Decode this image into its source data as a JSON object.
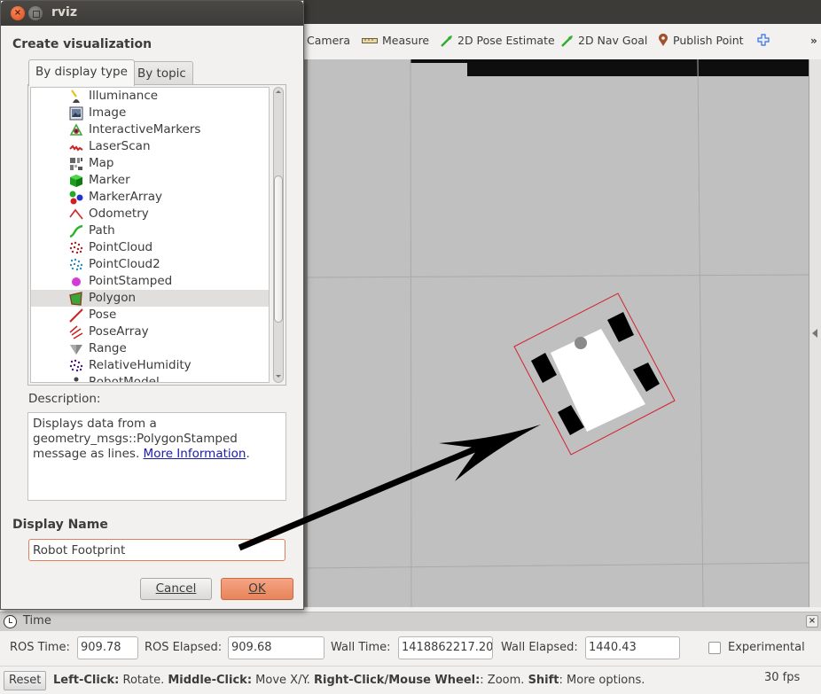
{
  "window": {
    "title": "rviz"
  },
  "toolbar": {
    "items": [
      {
        "label": "Camera",
        "icon": "camera-icon"
      },
      {
        "label": "Measure",
        "icon": "ruler-icon"
      },
      {
        "label": "2D Pose Estimate",
        "icon": "green-arrow-icon"
      },
      {
        "label": "2D Nav Goal",
        "icon": "green-arrow-icon"
      },
      {
        "label": "Publish Point",
        "icon": "map-pin-icon"
      },
      {
        "label": "",
        "icon": "plus-icon"
      }
    ],
    "overflow": "»"
  },
  "dialog": {
    "heading": "Create visualization",
    "tabs": [
      {
        "label": "By display type",
        "active": true
      },
      {
        "label": "By topic",
        "active": false
      }
    ],
    "display_types": [
      {
        "label": "Illuminance",
        "icon": "illuminance-icon"
      },
      {
        "label": "Image",
        "icon": "image-icon"
      },
      {
        "label": "InteractiveMarkers",
        "icon": "interactive-markers-icon"
      },
      {
        "label": "LaserScan",
        "icon": "laserscan-icon"
      },
      {
        "label": "Map",
        "icon": "map-icon"
      },
      {
        "label": "Marker",
        "icon": "marker-cube-icon"
      },
      {
        "label": "MarkerArray",
        "icon": "marker-array-icon"
      },
      {
        "label": "Odometry",
        "icon": "odometry-icon"
      },
      {
        "label": "Path",
        "icon": "path-icon"
      },
      {
        "label": "PointCloud",
        "icon": "pointcloud-icon"
      },
      {
        "label": "PointCloud2",
        "icon": "pointcloud2-icon"
      },
      {
        "label": "PointStamped",
        "icon": "point-stamped-icon"
      },
      {
        "label": "Polygon",
        "icon": "polygon-icon",
        "selected": true
      },
      {
        "label": "Pose",
        "icon": "pose-icon"
      },
      {
        "label": "PoseArray",
        "icon": "pose-array-icon"
      },
      {
        "label": "Range",
        "icon": "range-icon"
      },
      {
        "label": "RelativeHumidity",
        "icon": "relative-humidity-icon"
      },
      {
        "label": "RobotModel",
        "icon": "robot-model-icon"
      }
    ],
    "description_label": "Description:",
    "description_text": "Displays data from a geometry_msgs::PolygonStamped message as lines. ",
    "description_link": "More Information",
    "description_end": ".",
    "display_name_label": "Display Name",
    "display_name_value": "Robot Footprint",
    "cancel_label": "Cancel",
    "ok_label": "OK"
  },
  "time_panel": {
    "title": "Time",
    "ros_time_label": "ROS Time:",
    "ros_time": "909.78",
    "ros_elapsed_label": "ROS Elapsed:",
    "ros_elapsed": "909.68",
    "wall_time_label": "Wall Time:",
    "wall_time": "1418862217.20",
    "wall_elapsed_label": "Wall Elapsed:",
    "wall_elapsed": "1440.43",
    "experimental_label": "Experimental",
    "experimental_checked": false
  },
  "status_bar": {
    "reset_label": "Reset",
    "hint": [
      {
        "text": "Left-Click:",
        "bold": true
      },
      {
        "text": " Rotate. ",
        "bold": false
      },
      {
        "text": "Middle-Click:",
        "bold": true
      },
      {
        "text": " Move X/Y. ",
        "bold": false
      },
      {
        "text": "Right-Click/Mouse Wheel:",
        "bold": true
      },
      {
        "text": ": Zoom. ",
        "bold": false
      },
      {
        "text": "Shift",
        "bold": true
      },
      {
        "text": ": More options.",
        "bold": false
      }
    ],
    "fps": "30 fps"
  },
  "colors": {
    "footprint": "#d2222e",
    "viewport_bg": "#c0c0c0",
    "ok_button": "#e8845b",
    "link": "#1a1aa6"
  }
}
